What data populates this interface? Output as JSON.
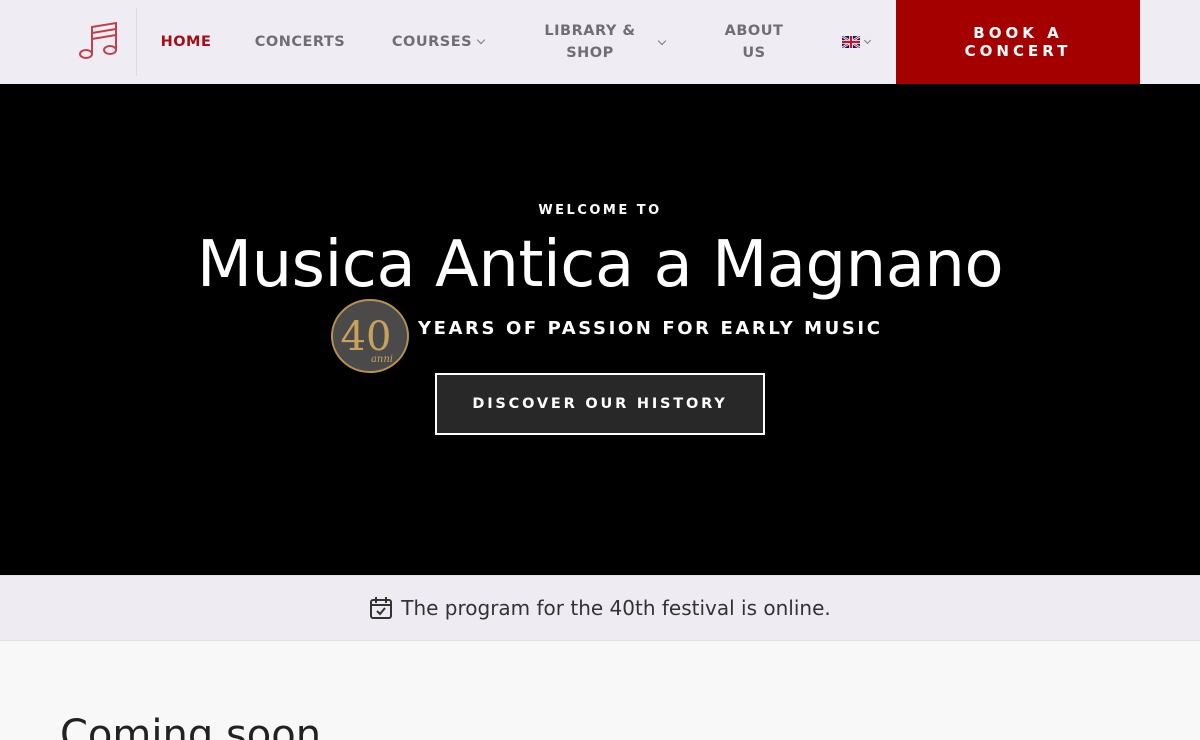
{
  "header": {
    "nav": {
      "home": "HOME",
      "concerts": "CONCERTS",
      "courses": "COURSES",
      "library_line1": "LIBRARY &",
      "library_line2": "SHOP",
      "about_line1": "ABOUT",
      "about_line2": "US"
    },
    "book_line1": "BOOK A",
    "book_line2": "CONCERT",
    "accent_color": "#a50000",
    "logo_icon": "music-notes-icon",
    "language_icon": "uk-flag-icon"
  },
  "hero": {
    "welcome": "WELCOME TO",
    "title": "Musica Antica a Magnano",
    "badge_number": "40",
    "badge_word": "anni",
    "tagline": "YEARS OF PASSION FOR EARLY MUSIC",
    "cta_label": "DISCOVER OUR HISTORY"
  },
  "notice": {
    "icon": "calendar-check-icon",
    "text": "The program for the 40th festival is online."
  },
  "section": {
    "heading": "Coming soon"
  }
}
